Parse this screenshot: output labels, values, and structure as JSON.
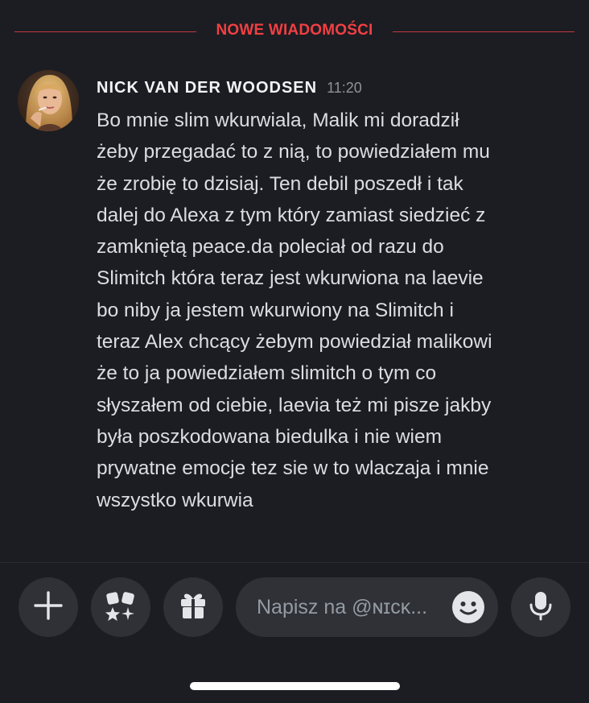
{
  "divider": {
    "label": "NOWE WIADOMOŚCI"
  },
  "message": {
    "author": "NICK VAN DER WOODSEN",
    "time": "11:20",
    "text": "Bo mnie slim wkurwiala, Malik mi doradził\nżeby przegadać to z nią, to powiedziałem mu\nże zrobię to dzisiaj. Ten debil poszedł i tak\ndalej do Alexa z tym który zamiast siedzieć z\nzamkniętą peace.da poleciał od razu do\nSlimitch która teraz jest wkurwiona na laevie\nbo niby ja jestem wkurwiony na Slimitch i\nteraz Alex chcący żebym powiedział malikowi\nże to ja powiedziałem slimitch o tym co\nsłyszałem od ciebie, laevia też mi pisze jakby\nbyła poszkodowana biedulka i nie wiem\nprywatne emocje tez sie w to wlaczaja i mnie\nwszystko wkurwia"
  },
  "composer": {
    "placeholder": "Napisz na @ɴɪᴄᴋ...",
    "icons": [
      "plus-icon",
      "apps-icon",
      "gift-icon",
      "emoji-icon",
      "microphone-icon"
    ]
  },
  "colors": {
    "background": "#1c1d22",
    "new_messages_accent": "#f23f43",
    "button_bg": "#2f3136"
  }
}
